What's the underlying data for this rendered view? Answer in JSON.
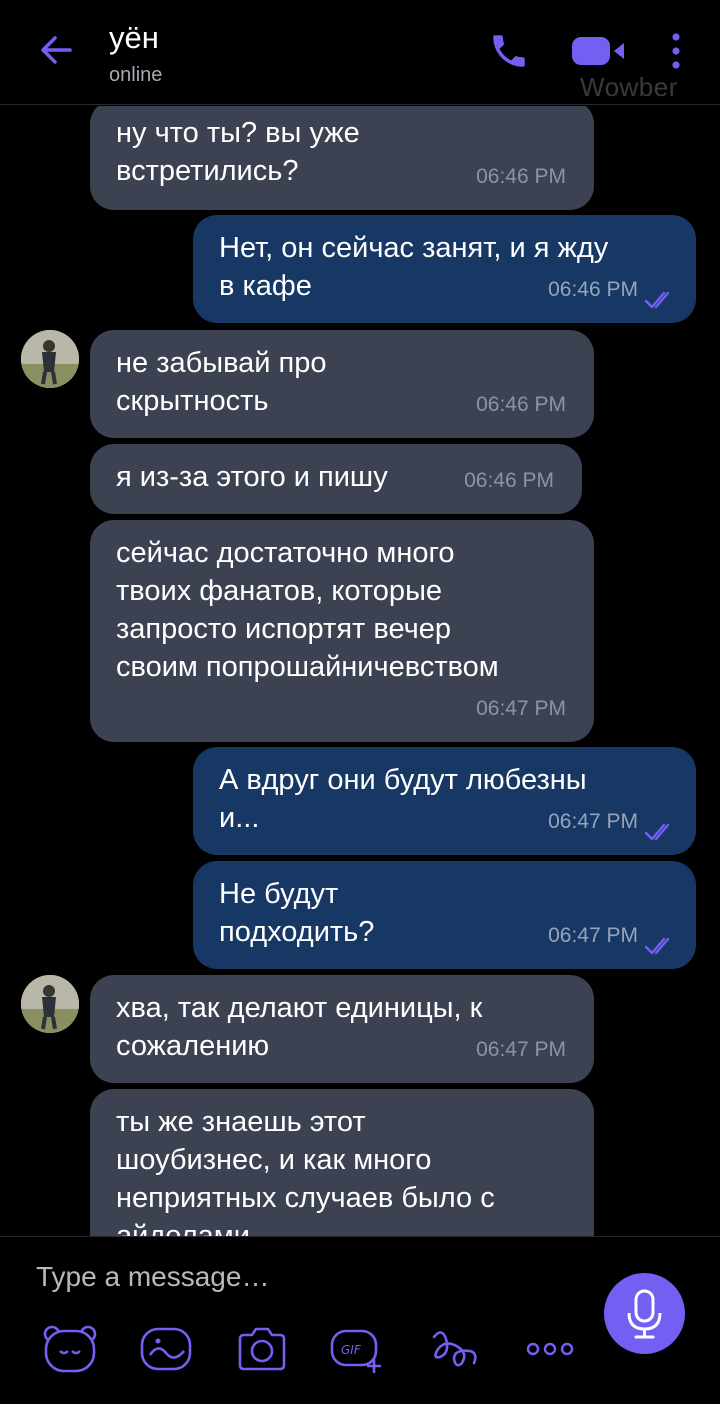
{
  "header": {
    "contact_name": "уён",
    "status": "online",
    "watermark": "Wowber",
    "icons": {
      "back": "back-arrow-icon",
      "call": "phone-icon",
      "video": "video-camera-icon",
      "menu": "more-vertical-icon"
    }
  },
  "messages": [
    {
      "direction": "in",
      "text": "ну что ты? вы уже\nвстретились?",
      "time": "06:46 PM"
    },
    {
      "direction": "out",
      "text": "Нет, он сейчас занят, и я жду\nв кафе",
      "time": "06:46 PM",
      "read": true
    },
    {
      "direction": "in",
      "text": "не забывай про\nскрытность",
      "time": "06:46 PM",
      "avatar": true
    },
    {
      "direction": "in",
      "text": "я из-за этого и пишу",
      "time": "06:46 PM"
    },
    {
      "direction": "in",
      "text": "сейчас достаточно много\nтвоих фанатов, которые\nзапросто испортят вечер\nсвоим попрошайничевством",
      "time": "06:47 PM"
    },
    {
      "direction": "out",
      "text": "А вдруг они будут любезны\nи...",
      "time": "06:47 PM",
      "read": true
    },
    {
      "direction": "out",
      "text": "Не будут\nподходить?",
      "time": "06:47 PM",
      "read": true
    },
    {
      "direction": "in",
      "text": "хва, так делают единицы, к\nсожалению",
      "time": "06:47 PM",
      "avatar": true
    },
    {
      "direction": "in",
      "text": "ты же знаешь этот\nшоубизнес, и как много\nнеприятных случаев было с\nайдолами",
      "time": ""
    }
  ],
  "composer": {
    "placeholder": "Type a message…",
    "tools": [
      "sticker-bear-icon",
      "doodle-icon",
      "camera-icon",
      "gif-icon",
      "flourish-icon",
      "more-horizontal-icon"
    ],
    "mic": "microphone-icon"
  },
  "colors": {
    "accent": "#7360f2",
    "incoming": "#3c4252",
    "outgoing": "#173764",
    "background": "#000000"
  }
}
